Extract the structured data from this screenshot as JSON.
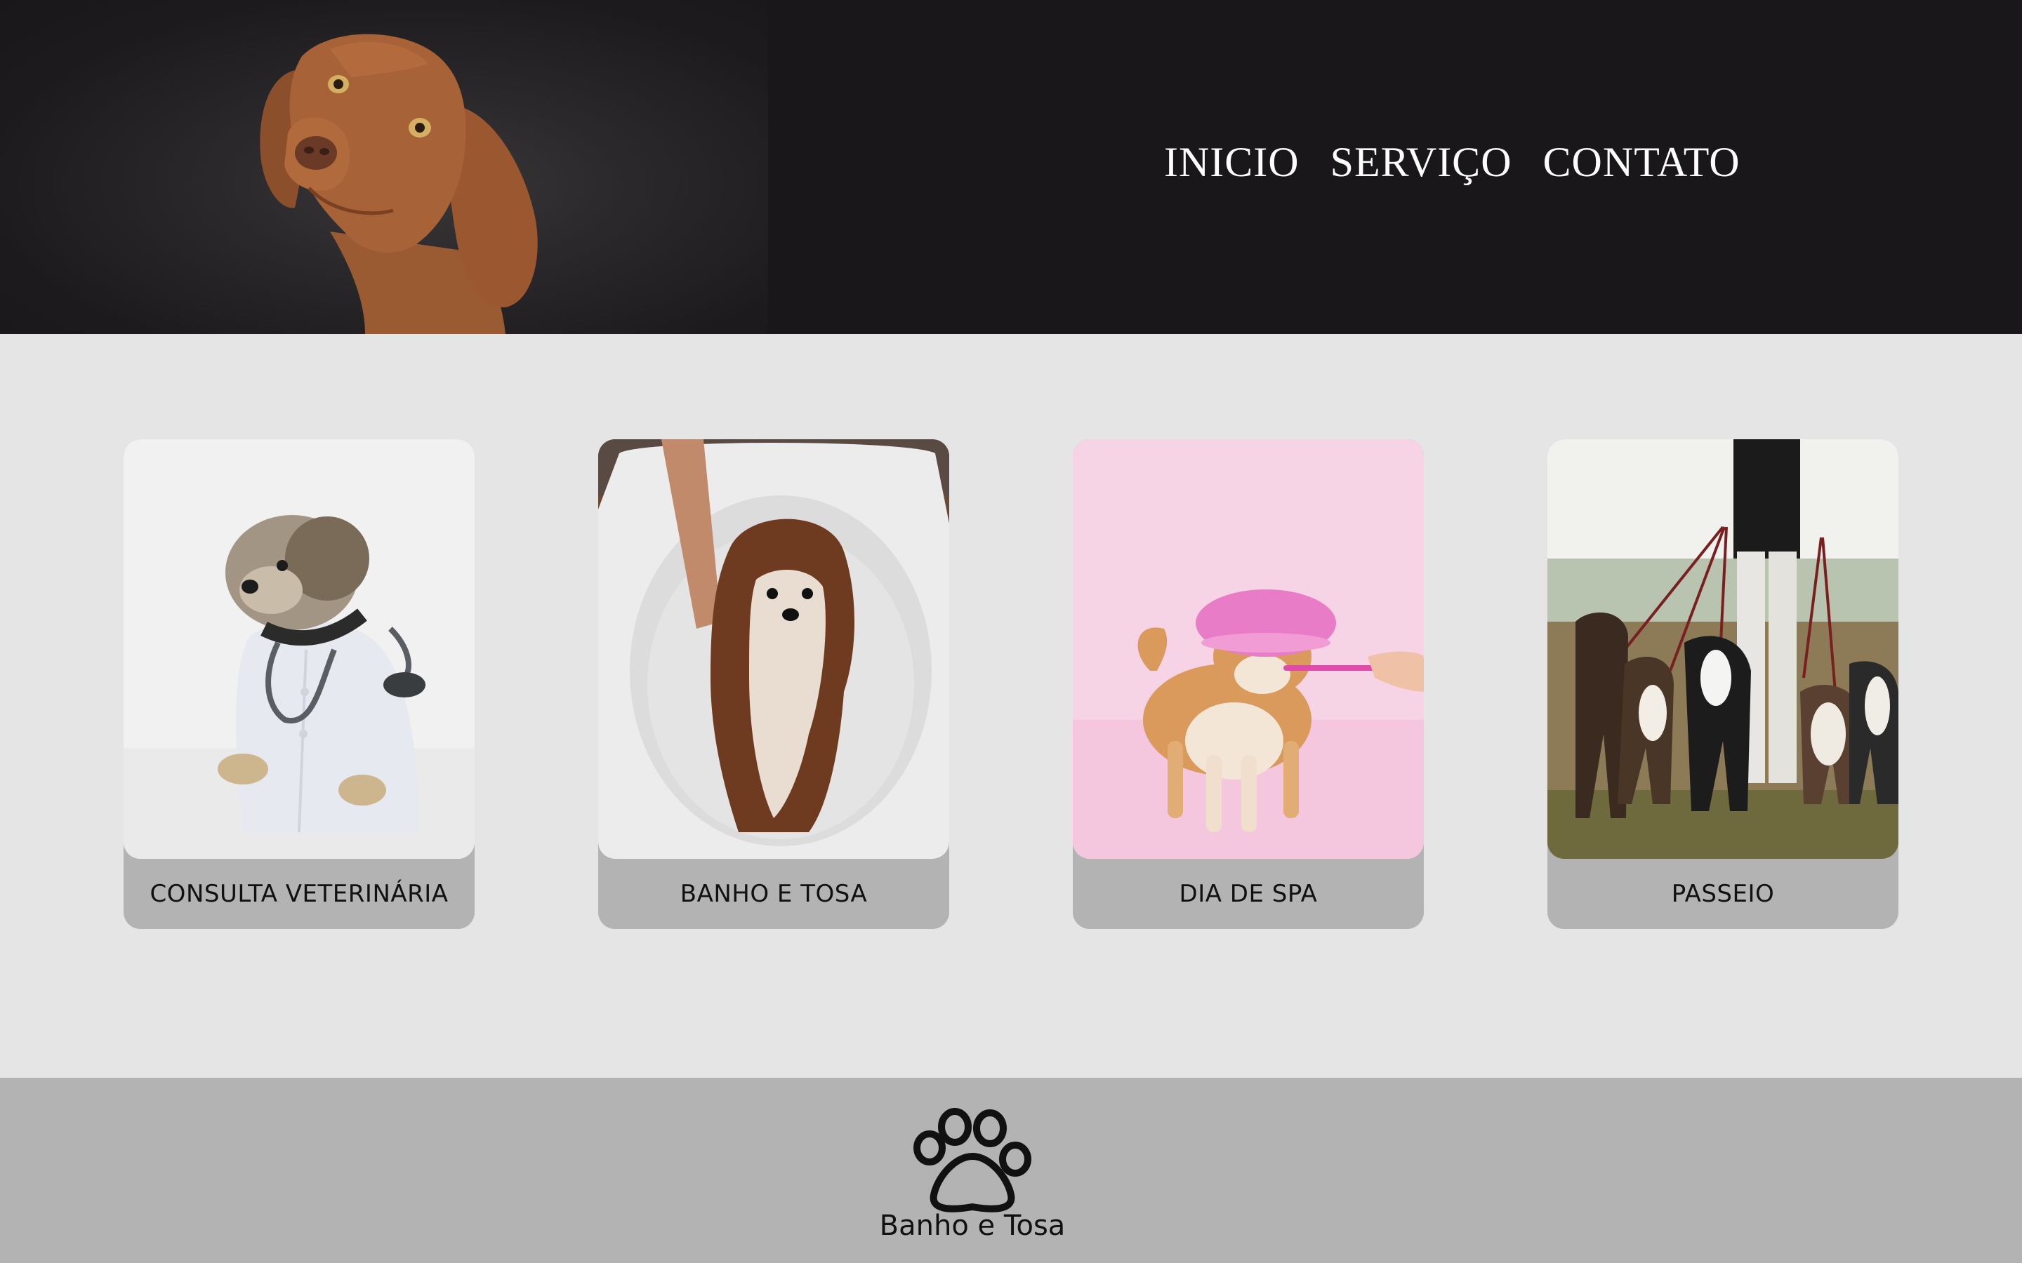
{
  "nav": {
    "items": [
      "INICIO",
      "SERVIÇO",
      "CONTATO"
    ]
  },
  "services": [
    {
      "label": "CONSULTA VETERINÁRIA",
      "image": "dog-in-doctor-coat-with-stethoscope"
    },
    {
      "label": "BANHO E TOSA",
      "image": "wet-shih-tzu-in-bath-tub"
    },
    {
      "label": "DIA DE SPA",
      "image": "shiba-inu-with-shower-cap-brushing-teeth"
    },
    {
      "label": "PASSEIO",
      "image": "dog-walker-with-many-dogs"
    }
  ],
  "footer": {
    "icon": "paw-icon",
    "brand": "Banho e Tosa"
  },
  "colors": {
    "header_bg": "#19171a",
    "page_bg": "#e5e5e5",
    "card_label_bg": "#b3b3b3",
    "footer_bg": "#b3b3b3",
    "nav_text": "#ffffff"
  }
}
